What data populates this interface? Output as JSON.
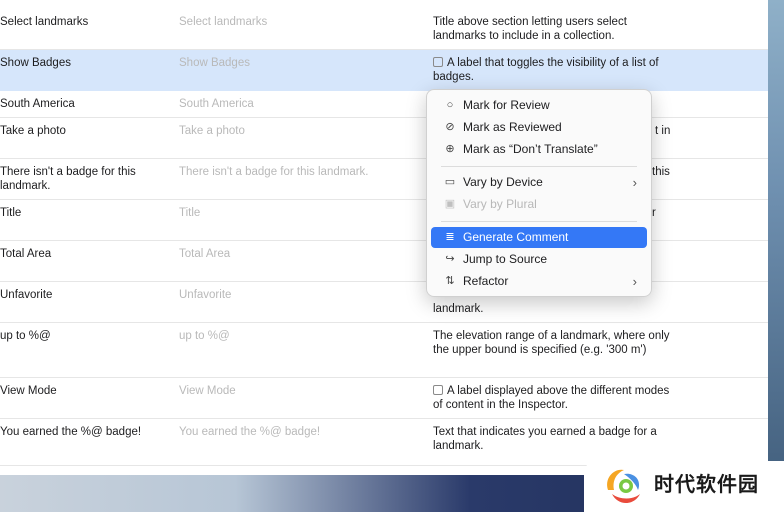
{
  "rows": [
    {
      "key": "Select landmarks",
      "value": "Select landmarks",
      "comment": "Title above section letting users select landmarks to include in a collection."
    },
    {
      "key": "Show Badges",
      "value": "Show Badges",
      "comment": "A label that toggles the visibility of a list of badges."
    },
    {
      "key": "South America",
      "value": "South America",
      "comment": ""
    },
    {
      "key": "Take a photo",
      "value": "Take a photo",
      "comment": "t in"
    },
    {
      "key": "There isn't a badge for this landmark.",
      "value": "There isn't a badge for this landmark.",
      "comment": "this"
    },
    {
      "key": "Title",
      "value": "Title",
      "comment": "r"
    },
    {
      "key": "Total Area",
      "value": "Total Area",
      "comment": ""
    },
    {
      "key": "Unfavorite",
      "value": "Unfavorite",
      "comment": "landmark."
    },
    {
      "key": "up to %@",
      "value": "up to %@",
      "comment": "The elevation range of a landmark, where only the upper bound is specified (e.g. '300 m')"
    },
    {
      "key": "View Mode",
      "value": "View Mode",
      "comment": "A label displayed above the different modes of content in the Inspector."
    },
    {
      "key": "You earned the %@ badge!",
      "value": "You earned the %@ badge!",
      "comment": "Text that indicates you earned a badge for a landmark."
    }
  ],
  "context_menu": {
    "items": [
      {
        "label": "Mark for Review",
        "icon": "circle-icon"
      },
      {
        "label": "Mark as Reviewed",
        "icon": "check-circle-icon"
      },
      {
        "label": "Mark as “Don’t Translate”",
        "icon": "globe-slash-icon"
      },
      {
        "label": "Vary by Device",
        "icon": "devices-icon"
      },
      {
        "label": "Vary by Plural",
        "icon": "plural-icon"
      },
      {
        "label": "Generate Comment",
        "icon": "comment-icon"
      },
      {
        "label": "Jump to Source",
        "icon": "arrow-turn-icon"
      },
      {
        "label": "Refactor",
        "icon": "refactor-icon"
      }
    ]
  },
  "watermark": {
    "text": "时代软件园"
  },
  "colors": {
    "accent": "#3478f6",
    "selection": "#d6e6fb"
  }
}
